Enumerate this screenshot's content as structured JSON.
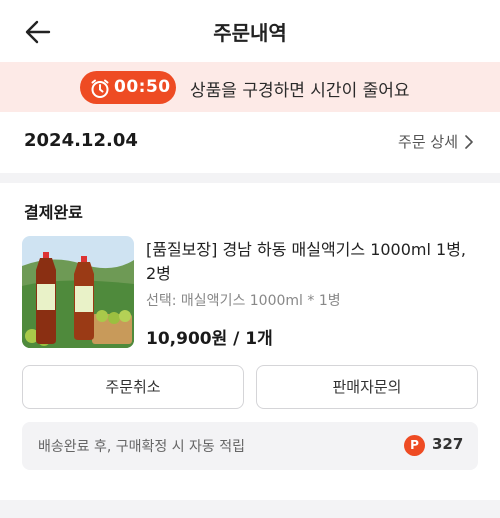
{
  "header": {
    "title": "주문내역",
    "back_icon": "arrow-left-icon"
  },
  "banner": {
    "timer_icon": "stopwatch-icon",
    "timer": "00:50",
    "message": "상품을 구경하면 시간이 줄어요",
    "colors": {
      "accent": "#ee4b23",
      "background": "#fdeae7"
    }
  },
  "order": {
    "date": "2024.12.04",
    "detail_label": "주문 상세",
    "status": "결제완료",
    "product": {
      "name": "[품질보장] 경남 하동 매실액기스 1000ml 1병, 2병",
      "option": "선택: 매실액기스 1000ml * 1병",
      "price": "10,900원 / 1개",
      "image_label": "경남하동 매실액기스"
    },
    "buttons": {
      "cancel": "주문취소",
      "seller_inquiry": "판매자문의"
    },
    "points": {
      "text": "배송완료 후, 구매확정 시 자동 적립",
      "icon_letter": "P",
      "value": "327"
    }
  }
}
